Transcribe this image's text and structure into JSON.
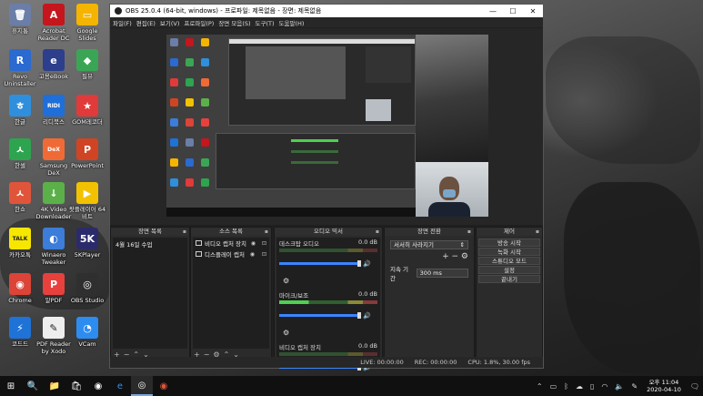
{
  "desktop": {
    "icons": [
      {
        "label": "휴지통",
        "color": "#6a7ea8",
        "glyph": "🗑"
      },
      {
        "label": "Acrobat Reader DC",
        "color": "#c4161c",
        "glyph": "A"
      },
      {
        "label": "Google Slides",
        "color": "#f4b400",
        "glyph": "▭"
      },
      {
        "label": "Revo Uninstaller",
        "color": "#2a6ad1",
        "glyph": "R"
      },
      {
        "label": "고용eBook",
        "color": "#2d3e8c",
        "glyph": "e"
      },
      {
        "label": "필뷰",
        "color": "#3aa655",
        "glyph": "◆"
      },
      {
        "label": "한글",
        "color": "#2f8fdc",
        "glyph": "ㅎ"
      },
      {
        "label": "리디북스",
        "color": "#1e6fd9",
        "glyph": "RIDI"
      },
      {
        "label": "GOM레코더",
        "color": "#e03a3a",
        "glyph": "★"
      },
      {
        "label": "한셀",
        "color": "#2ea44f",
        "glyph": "ㅅ"
      },
      {
        "label": "Samsung DeX",
        "color": "#f06a35",
        "glyph": "DeX"
      },
      {
        "label": "PowerPoint",
        "color": "#d04423",
        "glyph": "P"
      },
      {
        "label": "한쇼",
        "color": "#e0553a",
        "glyph": "ㅅ"
      },
      {
        "label": "4K Video Downloader",
        "color": "#5bb04a",
        "glyph": "↓"
      },
      {
        "label": "팟플레이어 64 비트",
        "color": "#f2c200",
        "glyph": "▶"
      },
      {
        "label": "카카오톡",
        "color": "#f7e600",
        "glyph": "TALK"
      },
      {
        "label": "Winaero Tweaker",
        "color": "#3b7dd8",
        "glyph": "◐"
      },
      {
        "label": "5KPlayer",
        "color": "#2b2b6b",
        "glyph": "5K"
      },
      {
        "label": "Chrome",
        "color": "#db4437",
        "glyph": "◉"
      },
      {
        "label": "알PDF",
        "color": "#e8413d",
        "glyph": "P"
      },
      {
        "label": "OBS Studio",
        "color": "#2f2f2f",
        "glyph": "◎"
      },
      {
        "label": "코드드",
        "color": "#1f72d6",
        "glyph": "⚡"
      },
      {
        "label": "PDF Reader by Xodo",
        "color": "#eeeeee",
        "glyph": "✎"
      },
      {
        "label": "VCam",
        "color": "#2d8cf0",
        "glyph": "◔"
      }
    ]
  },
  "obs": {
    "title": "OBS 25.0.4 (64-bit, windows) - 프로파일: 제목없음 - 장면: 제목없음",
    "menu": [
      "파일(F)",
      "편집(E)",
      "보기(V)",
      "프로파일(P)",
      "장면 모음(S)",
      "도구(T)",
      "도움말(H)"
    ],
    "docks": {
      "scenes": {
        "title": "장면 목록",
        "items": [
          "4월 16일 수업"
        ]
      },
      "sources": {
        "title": "소스 목록",
        "items": [
          "비디오 캡처 장치",
          "디스플레이 캡처"
        ]
      },
      "mixer": {
        "title": "오디오 믹서",
        "channels": [
          {
            "name": "데스크탑 오디오",
            "level": "0.0 dB"
          },
          {
            "name": "마이크/보조",
            "level": "0.0 dB"
          },
          {
            "name": "비디오 캡처 장치",
            "level": "0.0 dB"
          }
        ]
      },
      "transitions": {
        "title": "장면 전환",
        "type": "서서히 사라지기",
        "duration_label": "지속 기간",
        "duration_value": "300 ms"
      },
      "controls": {
        "title": "제어",
        "buttons": [
          "방송 시작",
          "녹화 시작",
          "스튜디오 모드",
          "설정",
          "끝내기"
        ]
      }
    },
    "status": {
      "live": "LIVE: 00:00:00",
      "rec": "REC: 00:00:00",
      "cpu": "CPU: 1.8%, 30.00 fps"
    }
  },
  "taskbar": {
    "apps": [
      "⊞",
      "🔍",
      "📁",
      "🛍",
      "◉",
      "e",
      "◎",
      "◉"
    ],
    "clock_time": "오후 11:04",
    "clock_date": "2020-04-10"
  }
}
